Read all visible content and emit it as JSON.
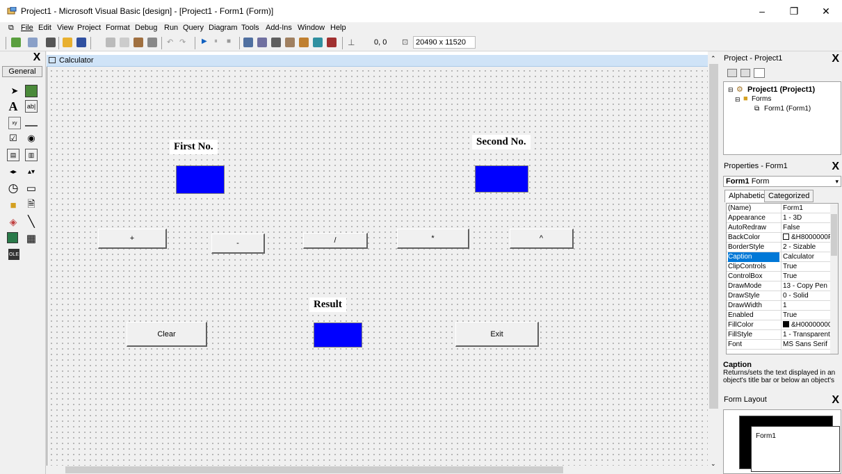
{
  "window": {
    "title": "Project1 - Microsoft Visual Basic [design] - [Project1 - Form1 (Form)]",
    "minimize": "–",
    "maximize": "❐",
    "close": "✕"
  },
  "menu": [
    "File",
    "Edit",
    "View",
    "Project",
    "Format",
    "Debug",
    "Run",
    "Query",
    "Diagram",
    "Tools",
    "Add-Ins",
    "Window",
    "Help"
  ],
  "mdi_controls": [
    "_",
    "🗗",
    "X"
  ],
  "toolbar": {
    "coords": "0, 0",
    "size": "20490 x 11520"
  },
  "toolbox": {
    "close": "X",
    "tab": "General"
  },
  "form": {
    "caption": "Calculator",
    "label_first": "First No.",
    "label_second": "Second No.",
    "label_result": "Result",
    "buttons": [
      "+",
      "-",
      "/",
      "*",
      "^"
    ],
    "clear": "Clear",
    "exit": "Exit"
  },
  "project_pane": {
    "title": "Project - Project1",
    "close": "X",
    "root": "Project1 (Project1)",
    "folder": "Forms",
    "item": "Form1 (Form1)"
  },
  "properties_pane": {
    "title": "Properties - Form1",
    "close": "X",
    "object_name": "Form1",
    "object_type": "Form",
    "tab_alpha": "Alphabetic",
    "tab_cat": "Categorized",
    "selected": "Caption",
    "rows": [
      {
        "name": "(Name)",
        "value": "Form1"
      },
      {
        "name": "Appearance",
        "value": "1 - 3D"
      },
      {
        "name": "AutoRedraw",
        "value": "False"
      },
      {
        "name": "BackColor",
        "value": "&H8000000F"
      },
      {
        "name": "BorderStyle",
        "value": "2 - Sizable"
      },
      {
        "name": "Caption",
        "value": "Calculator"
      },
      {
        "name": "ClipControls",
        "value": "True"
      },
      {
        "name": "ControlBox",
        "value": "True"
      },
      {
        "name": "DrawMode",
        "value": "13 - Copy Pen"
      },
      {
        "name": "DrawStyle",
        "value": "0 - Solid"
      },
      {
        "name": "DrawWidth",
        "value": "1"
      },
      {
        "name": "Enabled",
        "value": "True"
      },
      {
        "name": "FillColor",
        "value": "&H00000000"
      },
      {
        "name": "FillStyle",
        "value": "1 - Transparent"
      },
      {
        "name": "Font",
        "value": "MS Sans Serif"
      }
    ],
    "desc_title": "Caption",
    "desc_text": "Returns/sets the text displayed in an object's title bar or below an object's"
  },
  "layout_pane": {
    "title": "Form Layout",
    "close": "X",
    "form_caption": "Form1"
  },
  "colors": {
    "textbox": "#0000ff",
    "selection": "#0078d7",
    "form_titlebar": "#cfe3f7"
  }
}
